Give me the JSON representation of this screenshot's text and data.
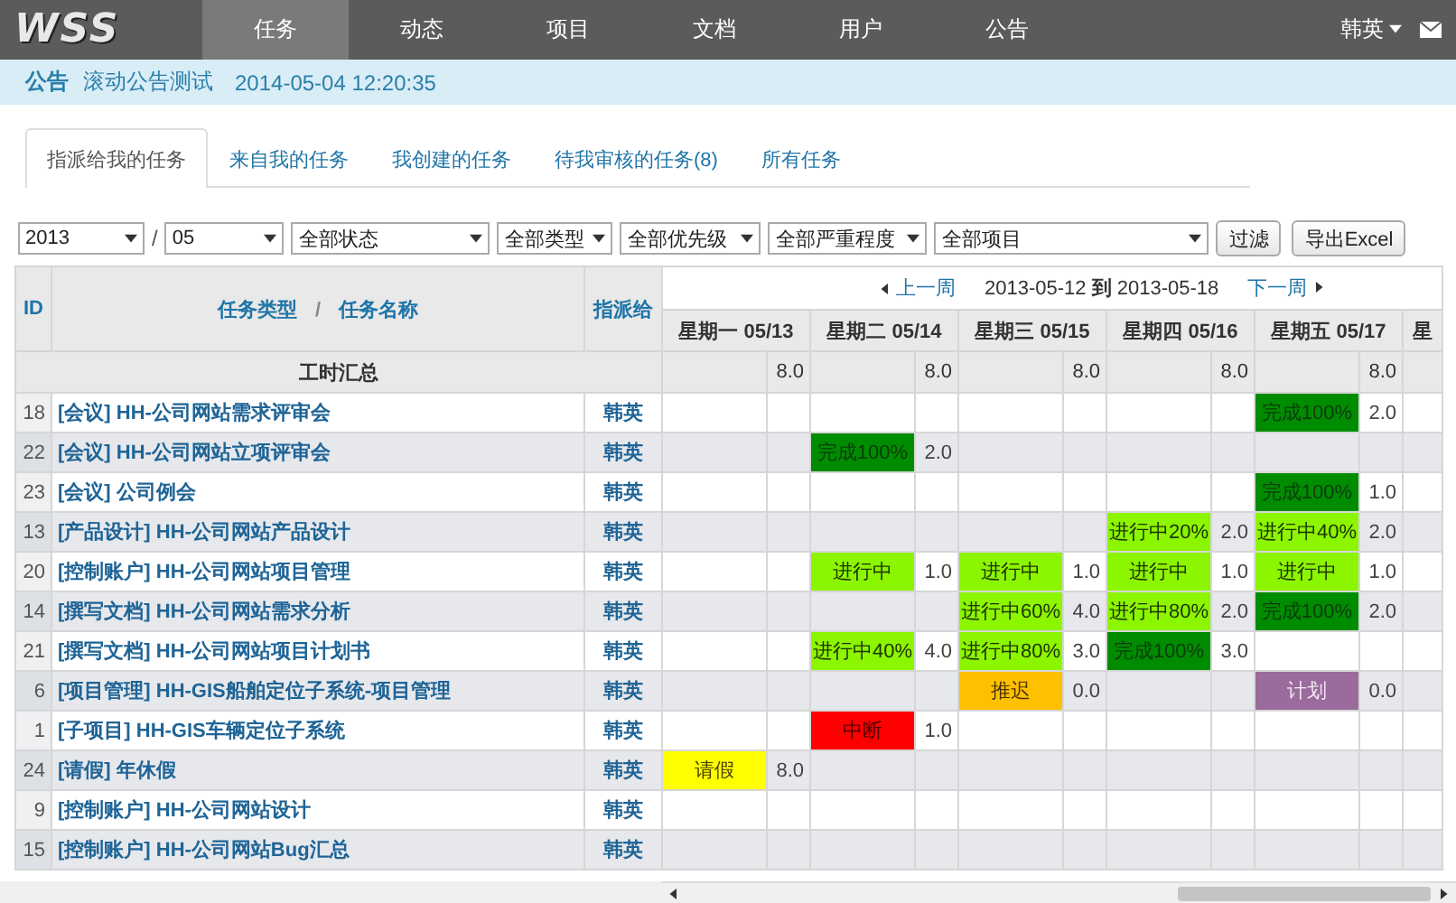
{
  "header": {
    "logo": "WSS",
    "nav": [
      {
        "label": "任务",
        "selected": true
      },
      {
        "label": "动态",
        "selected": false
      },
      {
        "label": "项目",
        "selected": false
      },
      {
        "label": "文档",
        "selected": false
      },
      {
        "label": "用户",
        "selected": false
      },
      {
        "label": "公告",
        "selected": false
      }
    ],
    "user": "韩英"
  },
  "notice": {
    "label": "公告",
    "text": "滚动公告测试",
    "time": "2014-05-04 12:20:35"
  },
  "tabs": [
    {
      "label": "指派给我的任务",
      "selected": true
    },
    {
      "label": "来自我的任务",
      "selected": false
    },
    {
      "label": "我创建的任务",
      "selected": false
    },
    {
      "label": "待我审核的任务(8)",
      "selected": false
    },
    {
      "label": "所有任务",
      "selected": false
    }
  ],
  "filters": {
    "year": "2013",
    "separator": "/",
    "month": "05",
    "selects": [
      "全部状态",
      "全部类型",
      "全部优先级",
      "全部严重程度",
      "全部项目"
    ],
    "buttons": [
      "过滤",
      "导出Excel"
    ]
  },
  "table": {
    "columns": {
      "id": "ID",
      "type": "任务类型",
      "slash": "/",
      "name": "任务名称",
      "assignee": "指派给"
    },
    "week": {
      "prev": "上一周",
      "range": "2013-05-12 **到** 2013-05-18",
      "next": "下一周"
    },
    "total_label": "工时汇总",
    "days": [
      {
        "label": "星期一 05/13",
        "total": "8.0"
      },
      {
        "label": "星期二 05/14",
        "total": "8.0"
      },
      {
        "label": "星期三 05/15",
        "total": "8.0"
      },
      {
        "label": "星期四 05/16",
        "total": "8.0"
      },
      {
        "label": "星期五 05/17",
        "total": "8.0"
      }
    ],
    "partial_day": "星",
    "rows": [
      {
        "id": "18",
        "task": "[会议] HH-公司网站需求评审会",
        "assignee": "韩英",
        "cells": [
          null,
          null,
          null,
          null,
          {
            "kind": "done",
            "text": "完成100%",
            "hours": "2.0"
          }
        ]
      },
      {
        "id": "22",
        "task": "[会议] HH-公司网站立项评审会",
        "assignee": "韩英",
        "cells": [
          null,
          {
            "kind": "done",
            "text": "完成100%",
            "hours": "2.0"
          },
          null,
          null,
          null
        ]
      },
      {
        "id": "23",
        "task": "[会议] 公司例会",
        "assignee": "韩英",
        "cells": [
          null,
          null,
          null,
          null,
          {
            "kind": "done",
            "text": "完成100%",
            "hours": "1.0"
          }
        ]
      },
      {
        "id": "13",
        "task": "[产品设计] HH-公司网站产品设计",
        "assignee": "韩英",
        "cells": [
          null,
          null,
          null,
          {
            "kind": "progress",
            "text": "进行中20%",
            "hours": "2.0"
          },
          {
            "kind": "progress",
            "text": "进行中40%",
            "hours": "2.0"
          }
        ]
      },
      {
        "id": "20",
        "task": "[控制账户] HH-公司网站项目管理",
        "assignee": "韩英",
        "cells": [
          null,
          {
            "kind": "progress",
            "text": "进行中",
            "hours": "1.0"
          },
          {
            "kind": "progress",
            "text": "进行中",
            "hours": "1.0"
          },
          {
            "kind": "progress",
            "text": "进行中",
            "hours": "1.0"
          },
          {
            "kind": "progress",
            "text": "进行中",
            "hours": "1.0"
          }
        ]
      },
      {
        "id": "14",
        "task": "[撰写文档] HH-公司网站需求分析",
        "assignee": "韩英",
        "cells": [
          null,
          null,
          {
            "kind": "progress",
            "text": "进行中60%",
            "hours": "4.0"
          },
          {
            "kind": "progress",
            "text": "进行中80%",
            "hours": "2.0"
          },
          {
            "kind": "done",
            "text": "完成100%",
            "hours": "2.0"
          }
        ]
      },
      {
        "id": "21",
        "task": "[撰写文档] HH-公司网站项目计划书",
        "assignee": "韩英",
        "cells": [
          null,
          {
            "kind": "progress",
            "text": "进行中40%",
            "hours": "4.0"
          },
          {
            "kind": "progress",
            "text": "进行中80%",
            "hours": "3.0"
          },
          {
            "kind": "done",
            "text": "完成100%",
            "hours": "3.0"
          },
          null
        ]
      },
      {
        "id": "6",
        "task": "[项目管理] HH-GIS船舶定位子系统-项目管理",
        "assignee": "韩英",
        "cells": [
          null,
          null,
          {
            "kind": "delayed",
            "text": "推迟",
            "hours": "0.0"
          },
          null,
          {
            "kind": "plan",
            "text": "计划",
            "hours": "0.0"
          }
        ]
      },
      {
        "id": "1",
        "task": "[子项目] HH-GIS车辆定位子系统",
        "assignee": "韩英",
        "cells": [
          null,
          {
            "kind": "interrupted",
            "text": "中断",
            "hours": "1.0"
          },
          null,
          null,
          null
        ]
      },
      {
        "id": "24",
        "task": "[请假] 年休假",
        "assignee": "韩英",
        "cells": [
          {
            "kind": "leave",
            "text": "请假",
            "hours": "8.0"
          },
          null,
          null,
          null,
          null
        ]
      },
      {
        "id": "9",
        "task": "[控制账户] HH-公司网站设计",
        "assignee": "韩英",
        "cells": [
          null,
          null,
          null,
          null,
          null
        ]
      },
      {
        "id": "15",
        "task": "[控制账户] HH-公司网站Bug汇总",
        "assignee": "韩英",
        "cells": [
          null,
          null,
          null,
          null,
          null
        ]
      }
    ]
  }
}
